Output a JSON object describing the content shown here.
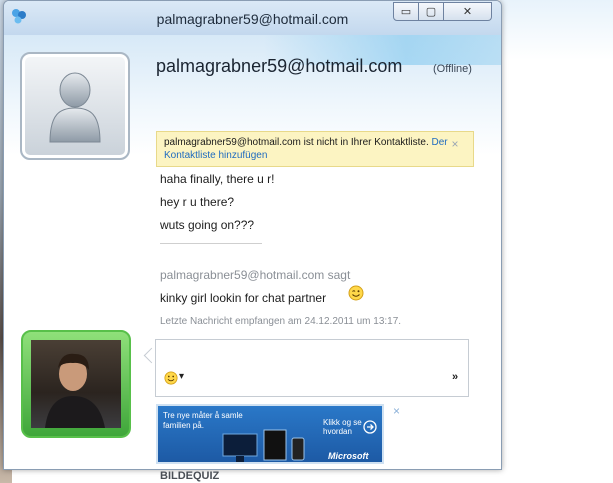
{
  "window": {
    "title": "palmagrabner59@hotmail.com",
    "controls": {
      "minimize": "▭",
      "maximize": "▢",
      "close": "✕"
    }
  },
  "contact": {
    "name": "palmagrabner59@hotmail.com",
    "status": "(Offline)"
  },
  "infobar": {
    "text": "palmagrabner59@hotmail.com ist nicht in Ihrer Kontaktliste.",
    "link": "Der Kontaktliste hinzufügen",
    "close": "×"
  },
  "conversation": {
    "messages": [
      "haha finally, there u r!",
      "hey r u there?",
      "wuts going on???"
    ],
    "sender_line": "palmagrabner59@hotmail.com sagt",
    "incoming": "kinky girl lookin for chat partner",
    "last_received": "Letzte Nachricht empfangen am 24.12.2011 um 13:17."
  },
  "input": {
    "emoticon_menu": "▾",
    "more": "»"
  },
  "ad": {
    "line1": "Tre nye måter å samle",
    "line2": "familien på.",
    "cta1": "Klikk og se",
    "cta2": "hvordan",
    "brand": "Microsoft",
    "close": "×"
  },
  "footer": {
    "text": "BILDEQUIZ"
  },
  "colors": {
    "accent_blue": "#1f6bbf",
    "infobar_bg": "#fcf4c2",
    "my_frame": "#58c04a",
    "contact_frame": "#aab7c4"
  }
}
